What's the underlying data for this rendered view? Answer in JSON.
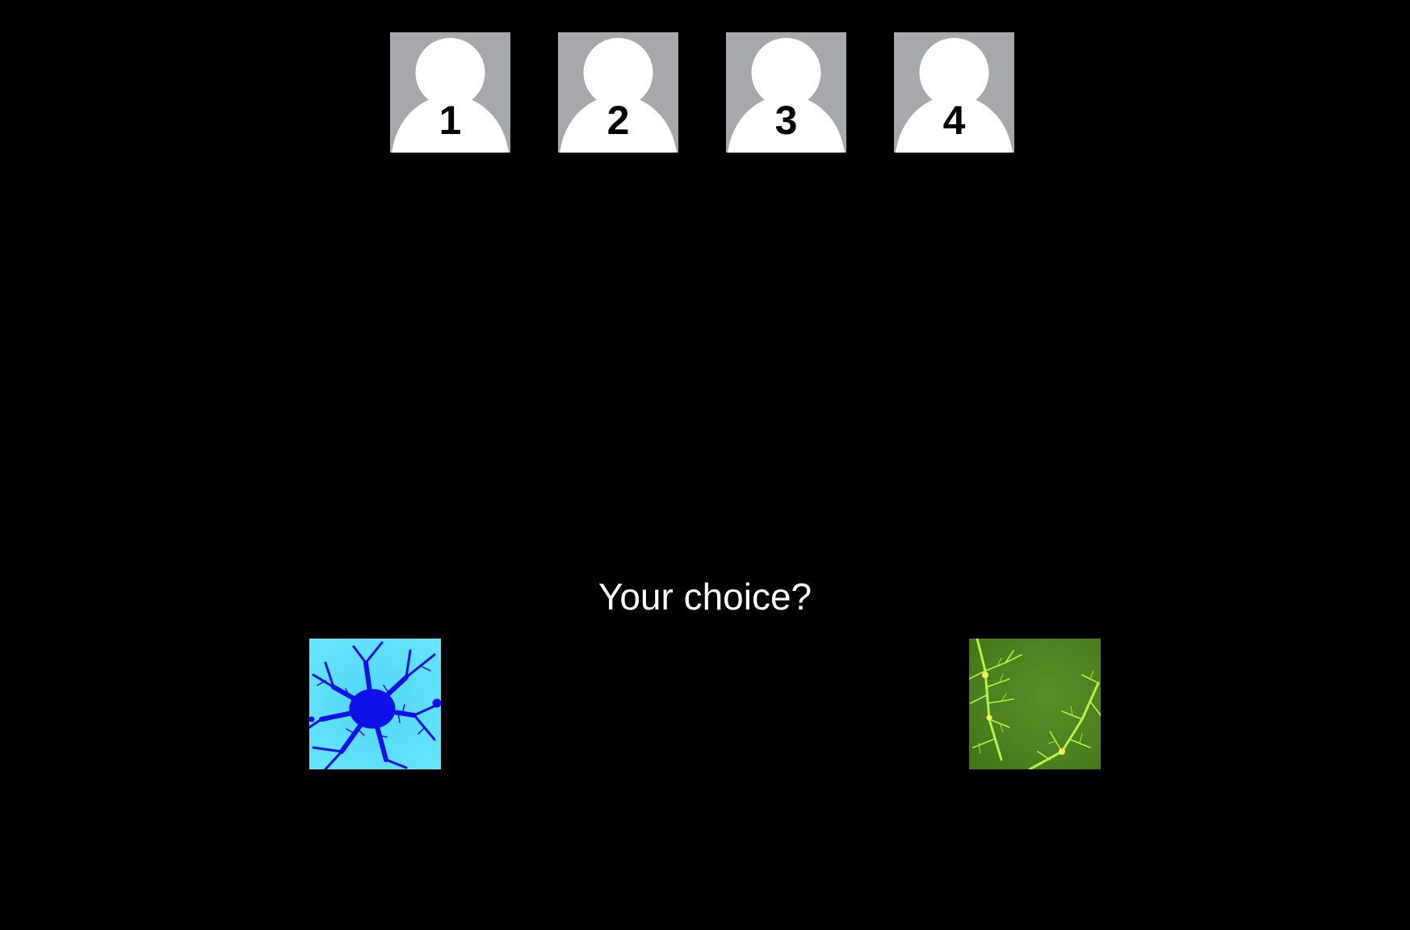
{
  "players": [
    {
      "number": "1",
      "icon": "person-silhouette-icon"
    },
    {
      "number": "2",
      "icon": "person-silhouette-icon"
    },
    {
      "number": "3",
      "icon": "person-silhouette-icon"
    },
    {
      "number": "4",
      "icon": "person-silhouette-icon"
    }
  ],
  "prompt": "Your choice?",
  "choices": [
    {
      "id": "left",
      "description": "blue fractal on cyan",
      "colors": {
        "background": "#5fe1fb",
        "fractal": "#1010e8"
      }
    },
    {
      "id": "right",
      "description": "yellow-green fractal on green",
      "colors": {
        "background": "#4a7f1e",
        "fractal": "#b8f04a"
      }
    }
  ],
  "colors": {
    "background": "#000000",
    "avatar_bg": "#a7a8ab",
    "silhouette": "#ffffff",
    "text": "#ffffff"
  }
}
